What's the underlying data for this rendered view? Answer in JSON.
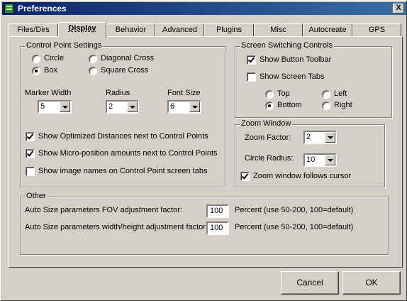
{
  "window": {
    "title": "Preferences",
    "close_label": "X"
  },
  "tabs": [
    {
      "label": "Files/Dirs"
    },
    {
      "label": "Display"
    },
    {
      "label": "Behavior"
    },
    {
      "label": "Advanced"
    },
    {
      "label": "Plugins"
    },
    {
      "label": "Misc"
    },
    {
      "label": "Autocreate"
    },
    {
      "label": "GPS"
    }
  ],
  "active_tab": "Display",
  "control_point": {
    "legend": "Control Point Settings",
    "shape_options": [
      {
        "label": "Circle",
        "selected": false
      },
      {
        "label": "Box",
        "selected": true
      },
      {
        "label": "Diagonal Cross",
        "selected": false
      },
      {
        "label": "Square Cross",
        "selected": false
      }
    ],
    "marker_width": {
      "label": "Marker Width",
      "value": "5"
    },
    "radius": {
      "label": "Radius",
      "value": "2"
    },
    "font_size": {
      "label": "Font Size",
      "value": "6"
    },
    "checks": [
      {
        "label": "Show Optimized Distances next to Control Points",
        "checked": true
      },
      {
        "label": "Show Micro-position amounts next to Control Points",
        "checked": true
      },
      {
        "label": "Show image names on Control Point screen tabs",
        "checked": false
      }
    ]
  },
  "screen_switching": {
    "legend": "Screen Switching Controls",
    "show_button_toolbar": {
      "label": "Show Button Toolbar",
      "checked": true
    },
    "show_screen_tabs": {
      "label": "Show Screen Tabs",
      "checked": false
    },
    "positions": [
      {
        "label": "Top",
        "selected": false
      },
      {
        "label": "Left",
        "selected": false
      },
      {
        "label": "Bottom",
        "selected": true
      },
      {
        "label": "Right",
        "selected": false
      }
    ]
  },
  "zoom_window": {
    "legend": "Zoom Window",
    "zoom_factor": {
      "label": "Zoom Factor:",
      "value": "2"
    },
    "circle_radius": {
      "label": "Circle Radius:",
      "value": "10"
    },
    "follows_cursor": {
      "label": "Zoom window follows cursor",
      "checked": true
    }
  },
  "other": {
    "legend": "Other",
    "fov": {
      "label": "Auto Size parameters FOV adjustment factor:",
      "value": "100",
      "hint": "Percent (use 50-200, 100=default)"
    },
    "wh": {
      "label": "Auto Size parameters width/height adjustment factor:",
      "value": "100",
      "hint": "Percent (use 50-200, 100=default)"
    }
  },
  "buttons": {
    "cancel": "Cancel",
    "ok": "OK"
  }
}
